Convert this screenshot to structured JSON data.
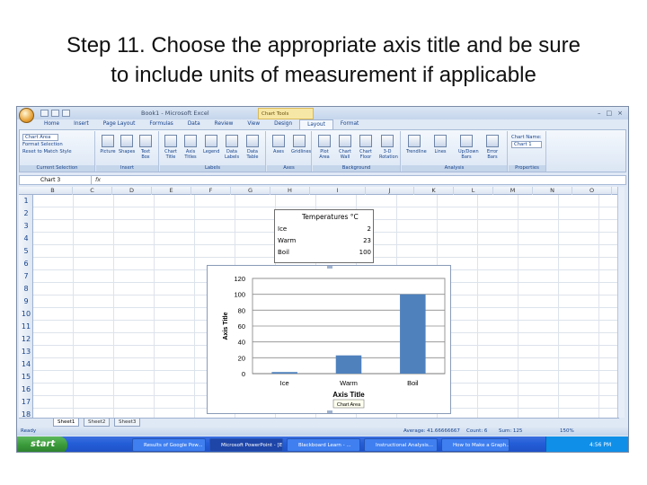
{
  "slide": {
    "title_line1": "Step 11. Choose the appropriate axis title and be sure",
    "title_line2": "to include units of measurement if applicable"
  },
  "window": {
    "title": "Book1 - Microsoft Excel",
    "chart_tools": "Chart Tools",
    "buttons": [
      "–",
      "□",
      "×"
    ]
  },
  "ribbon": {
    "tabs": [
      "Home",
      "Insert",
      "Page Layout",
      "Formulas",
      "Data",
      "Review",
      "View",
      "Design",
      "Layout",
      "Format"
    ],
    "active_tab": "Layout",
    "current_selection": {
      "dropdown": "Chart Area",
      "format_selection": "Format Selection",
      "reset": "Reset to Match Style",
      "label": "Current Selection"
    },
    "insert": {
      "buttons": [
        "Picture",
        "Shapes",
        "Text Box"
      ],
      "label": "Insert"
    },
    "labels": {
      "buttons": [
        "Chart Title",
        "Axis Titles",
        "Legend",
        "Data Labels",
        "Data Table"
      ],
      "label": "Labels"
    },
    "axes": {
      "buttons": [
        "Axes",
        "Gridlines"
      ],
      "label": "Axes"
    },
    "background": {
      "buttons": [
        "Plot Area",
        "Chart Wall",
        "Chart Floor",
        "3-D Rotation"
      ],
      "label": "Background"
    },
    "analysis": {
      "buttons": [
        "Trendline",
        "Lines",
        "Up/Down Bars",
        "Error Bars"
      ],
      "label": "Analysis"
    },
    "properties": {
      "name_label": "Chart Name:",
      "name_value": "Chart 1",
      "label": "Properties"
    }
  },
  "formula_bar": {
    "name_box": "Chart 3",
    "fx": "fx"
  },
  "columns": [
    "B",
    "C",
    "D",
    "E",
    "F",
    "G",
    "H",
    "I",
    "J",
    "K",
    "L",
    "M",
    "N",
    "O"
  ],
  "rows": [
    "1",
    "2",
    "3",
    "4",
    "5",
    "6",
    "7",
    "8",
    "9",
    "10",
    "11",
    "12",
    "13",
    "14",
    "15",
    "16",
    "17",
    "18"
  ],
  "data_table": {
    "header": "Temperatures °C",
    "rows": [
      {
        "label": "Ice",
        "value": "2"
      },
      {
        "label": "Warm",
        "value": "23"
      },
      {
        "label": "Boil",
        "value": "100"
      }
    ]
  },
  "chart_data": {
    "type": "bar",
    "categories": [
      "Ice",
      "Warm",
      "Boil"
    ],
    "values": [
      2,
      23,
      100
    ],
    "title": "",
    "xlabel": "Axis Title",
    "ylabel": "Axis Title",
    "ylim": [
      0,
      120
    ],
    "yticks": [
      0,
      20,
      40,
      60,
      80,
      100,
      120
    ],
    "grid": true,
    "legend": "none",
    "bar_color": "#4f81bd",
    "tooltip": "Chart Area"
  },
  "sheet_tabs": [
    "Sheet1",
    "Sheet2",
    "Sheet3"
  ],
  "status_bar": {
    "mode": "Ready",
    "average": "Average: 41.66666667",
    "count": "Count: 6",
    "sum": "Sum: 125",
    "zoom": "150%"
  },
  "taskbar": {
    "start": "start",
    "items": [
      "Results of Google Pow...",
      "Microsoft PowerPoint - [Excel]",
      "Blackboard Learn - ...",
      "Instructional Analysis...",
      "How to Make a Graph..."
    ],
    "clock": "4:56 PM"
  }
}
